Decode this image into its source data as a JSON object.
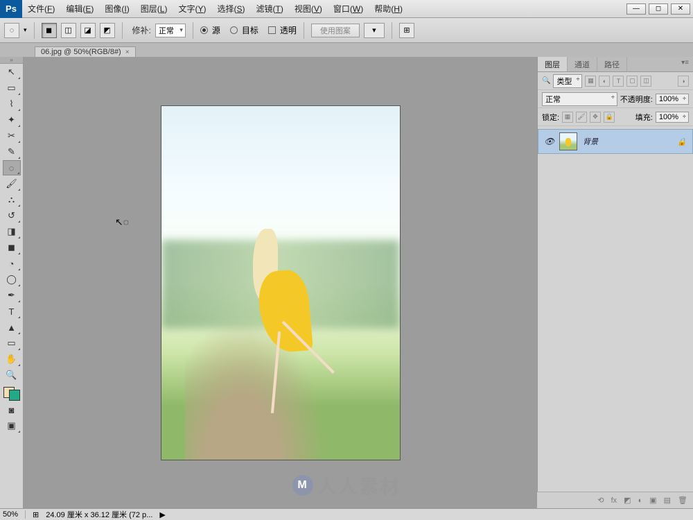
{
  "app": {
    "logo": "Ps"
  },
  "menu": {
    "items": [
      {
        "label": "文件",
        "key": "F"
      },
      {
        "label": "编辑",
        "key": "E"
      },
      {
        "label": "图像",
        "key": "I"
      },
      {
        "label": "图层",
        "key": "L"
      },
      {
        "label": "文字",
        "key": "Y"
      },
      {
        "label": "选择",
        "key": "S"
      },
      {
        "label": "滤镜",
        "key": "T"
      },
      {
        "label": "视图",
        "key": "V"
      },
      {
        "label": "窗口",
        "key": "W"
      },
      {
        "label": "帮助",
        "key": "H"
      }
    ]
  },
  "options": {
    "patch_label": "修补:",
    "patch_mode": "正常",
    "source_label": "源",
    "target_label": "目标",
    "transparent_label": "透明",
    "use_pattern": "使用图案"
  },
  "document": {
    "tab_title": "06.jpg @ 50%(RGB/8#)",
    "close_glyph": "×"
  },
  "panels": {
    "tabs": {
      "layers": "图层",
      "channels": "通道",
      "paths": "路径"
    },
    "layer_filter": {
      "kind": "类型"
    },
    "blend": {
      "mode": "正常",
      "opacity_label": "不透明度:",
      "opacity_value": "100%"
    },
    "lock": {
      "label": "锁定:",
      "fill_label": "填充:",
      "fill_value": "100%"
    },
    "layer": {
      "name": "背景"
    }
  },
  "status": {
    "zoom": "50%",
    "doc_info": "24.09 厘米 x 36.12 厘米 (72 p...",
    "arrow": "▶"
  },
  "watermark": {
    "text": "人人素材"
  },
  "icons": {
    "minimize": "—",
    "restore": "◻",
    "close": "✕",
    "arrow_dn": "▾",
    "eye": "👁",
    "lock": "🔒",
    "link": "⟲",
    "fx": "fx",
    "mask": "◩",
    "adj": "◐",
    "folder": "▣",
    "new": "▤",
    "trash": "🗑"
  }
}
